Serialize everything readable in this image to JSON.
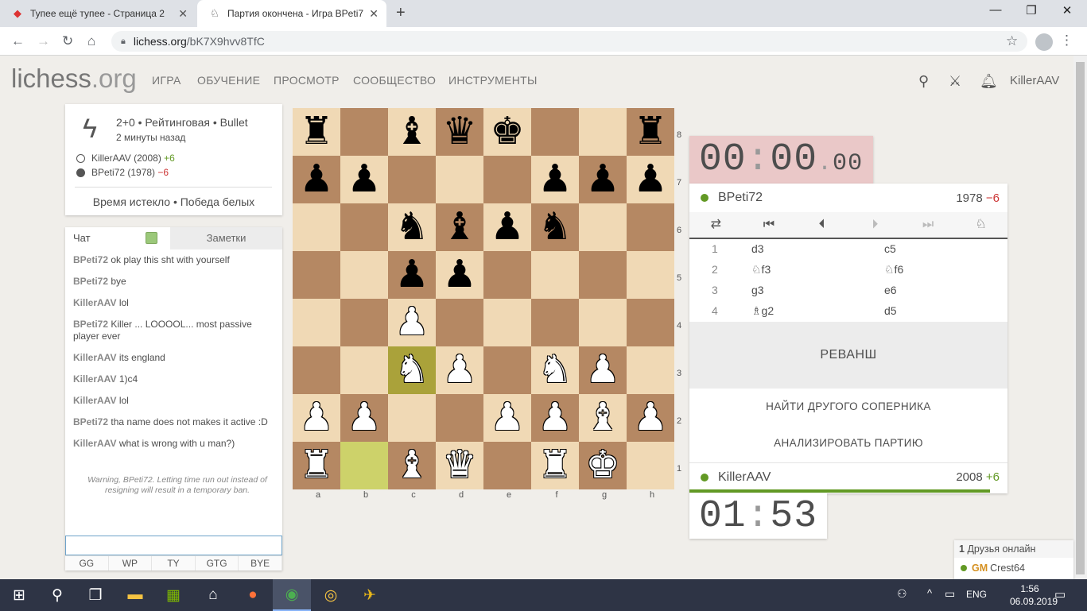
{
  "browser": {
    "tabs": [
      {
        "title": "Тупее ещё тупее - Страница 2"
      },
      {
        "title": "Партия окончена - Игра BPeti7"
      }
    ],
    "url_host": "lichess.org",
    "url_path": "/bK7X9hvv8TfC"
  },
  "site": {
    "logo_main": "lichess",
    "logo_suffix": ".org",
    "nav": [
      "ИГРА",
      "ОБУЧЕНИЕ",
      "ПРОСМОТР",
      "СООБЩЕСТВО",
      "ИНСТРУМЕНТЫ"
    ],
    "username": "KillerAAV"
  },
  "game_info": {
    "mode": "2+0 • Рейтинговая • Bullet",
    "ago": "2 минуты назад",
    "white": {
      "name": "KillerAAV (2008)",
      "diff": "+6"
    },
    "black": {
      "name": "BPeti72 (1978)",
      "diff": "−6"
    },
    "result": "Время истекло • Победа белых"
  },
  "chat": {
    "tab_chat": "Чат",
    "tab_notes": "Заметки",
    "messages": [
      {
        "user": "BPeti72",
        "text": "ok play this sht with yourself"
      },
      {
        "user": "BPeti72",
        "text": "bye"
      },
      {
        "user": "KillerAAV",
        "text": "lol"
      },
      {
        "user": "BPeti72",
        "text": "Killer ... LOOOOL... most passive player ever"
      },
      {
        "user": "KillerAAV",
        "text": "its england"
      },
      {
        "user": "KillerAAV",
        "text": "1)c4"
      },
      {
        "user": "KillerAAV",
        "text": "lol"
      },
      {
        "user": "BPeti72",
        "text": "tha name does not makes it active :D"
      },
      {
        "user": "KillerAAV",
        "text": "what is wrong with u man?)"
      }
    ],
    "warning": "Warning, BPeti72. Letting time run out instead of resigning will result in a temporary ban.",
    "quick_replies": [
      "GG",
      "WP",
      "TY",
      "GTG",
      "BYE"
    ]
  },
  "board": {
    "rows": [
      [
        "br",
        "",
        "bb",
        "bq",
        "bk",
        "",
        "",
        "br"
      ],
      [
        "bp",
        "bp",
        "",
        "",
        "",
        "bp",
        "bp",
        "bp"
      ],
      [
        "",
        "",
        "bn",
        "bb",
        "bp",
        "bn",
        "",
        ""
      ],
      [
        "",
        "",
        "bp",
        "bp",
        "",
        "",
        "",
        ""
      ],
      [
        "",
        "",
        "wp",
        "",
        "",
        "",
        "",
        ""
      ],
      [
        "",
        "",
        "wn",
        "wp",
        "",
        "wn",
        "wp",
        ""
      ],
      [
        "wp",
        "wp",
        "",
        "",
        "wp",
        "wp",
        "wb",
        "wp"
      ],
      [
        "wr",
        "",
        "wb",
        "wq",
        "",
        "wr",
        "wk",
        ""
      ]
    ],
    "highlights": [
      [
        5,
        2
      ],
      [
        7,
        1
      ]
    ],
    "ranks": [
      "8",
      "7",
      "6",
      "5",
      "4",
      "3",
      "2",
      "1"
    ],
    "files": [
      "a",
      "b",
      "c",
      "d",
      "e",
      "f",
      "g",
      "h"
    ]
  },
  "clocks": {
    "top_main": "00",
    "top_sec": "00",
    "top_tenths": "0",
    "bottom_min": "01",
    "bottom_sec": "53"
  },
  "panel": {
    "top_player": {
      "name": "BPeti72",
      "rating": "1978",
      "diff": "−6"
    },
    "bottom_player": {
      "name": "KillerAAV",
      "rating": "2008",
      "diff": "+6"
    },
    "moves": [
      {
        "n": "1",
        "w": "d3",
        "b": "c5"
      },
      {
        "n": "2",
        "w": "♘f3",
        "b": "♘f6"
      },
      {
        "n": "3",
        "w": "g3",
        "b": "e6"
      },
      {
        "n": "4",
        "w": "♗g2",
        "b": "d5"
      }
    ],
    "rematch": "РЕВАНШ",
    "new_opponent": "НАЙТИ ДРУГОГО СОПЕРНИКА",
    "analyse": "АНАЛИЗИРОВАТЬ ПАРТИЮ"
  },
  "friends": {
    "count": "1",
    "label": "Друзья онлайн",
    "list": [
      {
        "title": "GM",
        "name": "Crest64"
      }
    ]
  },
  "taskbar": {
    "lang": "ENG",
    "time": "1:56",
    "date": "06.09.2019"
  }
}
